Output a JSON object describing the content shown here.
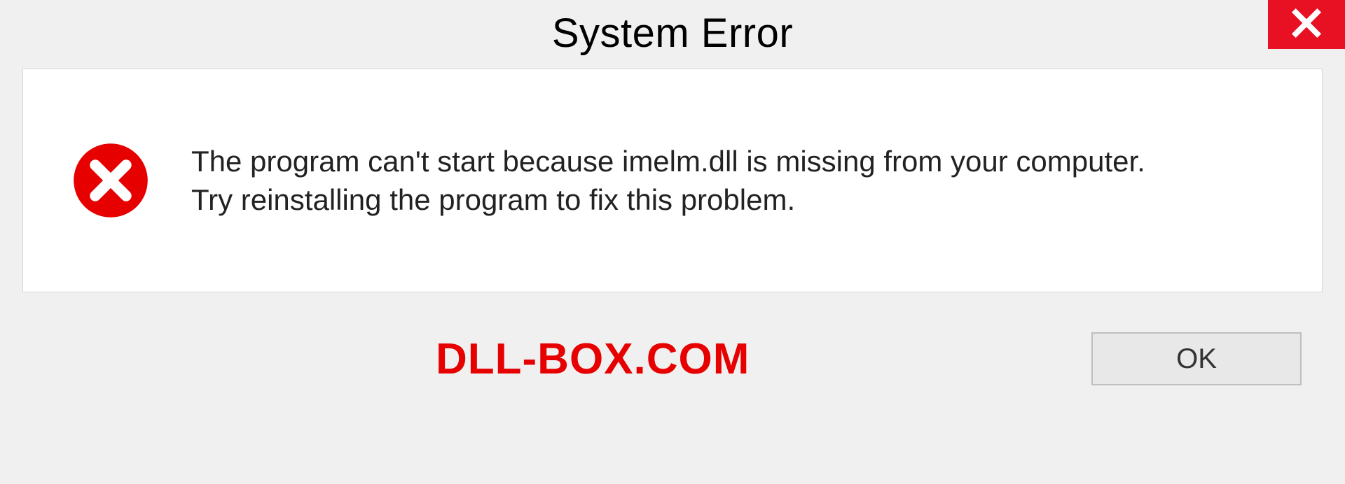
{
  "dialog": {
    "title": "System Error",
    "message_line1": "The program can't start because imelm.dll is missing from your computer.",
    "message_line2": "Try reinstalling the program to fix this problem.",
    "ok_label": "OK"
  },
  "watermark": "DLL-BOX.COM",
  "colors": {
    "close_bg": "#e81123",
    "error_red": "#e60000"
  }
}
